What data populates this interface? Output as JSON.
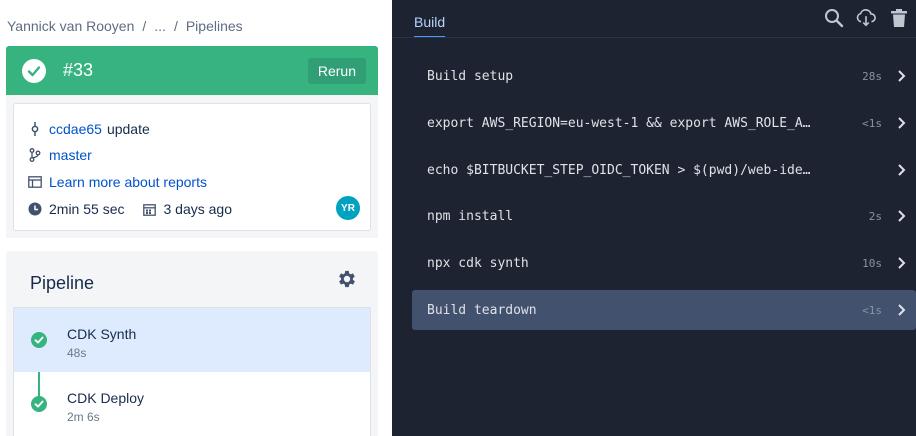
{
  "breadcrumb": {
    "owner": "Yannick van Rooyen",
    "middle": "...",
    "current": "Pipelines"
  },
  "run": {
    "number": "#33",
    "rerun_label": "Rerun",
    "status_color": "#36b37e"
  },
  "info": {
    "commit_hash": "ccdae65",
    "commit_message": "update",
    "branch": "master",
    "reports_link": "Learn more about reports",
    "duration": "2min 55 sec",
    "age": "3 days ago",
    "avatar_initials": "YR"
  },
  "pipeline": {
    "title": "Pipeline",
    "steps": [
      {
        "name": "CDK Synth",
        "duration": "48s"
      },
      {
        "name": "CDK Deploy",
        "duration": "2m 6s"
      }
    ]
  },
  "log": {
    "tab_label": "Build",
    "commands": [
      {
        "label": "Build setup",
        "time": "28s"
      },
      {
        "label": "export AWS_REGION=eu-west-1 && export AWS_ROLE_A…",
        "time": "<1s"
      },
      {
        "label": "echo $BITBUCKET_STEP_OIDC_TOKEN > $(pwd)/web-ide…",
        "time": ""
      },
      {
        "label": "npm install",
        "time": "2s"
      },
      {
        "label": "npx cdk synth",
        "time": "10s"
      },
      {
        "label": "Build teardown",
        "time": "<1s"
      }
    ]
  },
  "icons": [
    "commit-icon",
    "branch-icon",
    "reports-icon",
    "clock-icon",
    "calendar-icon",
    "gear-icon",
    "search-icon",
    "download-icon",
    "trash-icon",
    "chevron-right-icon",
    "check-icon"
  ]
}
